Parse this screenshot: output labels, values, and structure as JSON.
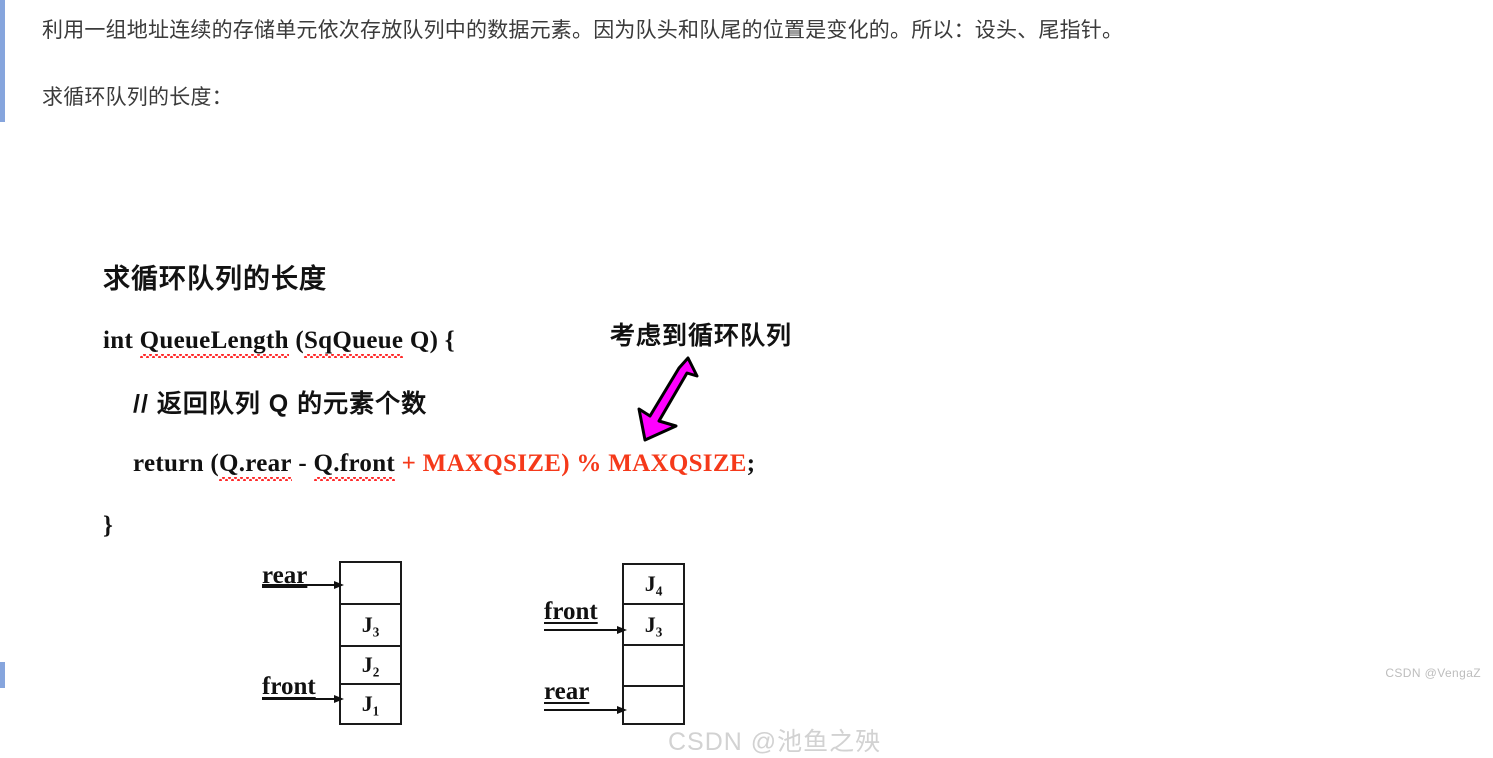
{
  "page": {
    "accent_color": "#86a5dd",
    "background": "#ffffff"
  },
  "article": {
    "paragraph_1": "利用一组地址连续的存储单元依次存放队列中的数据元素。因为队头和队尾的位置是变化的。所以：设头、尾指针。",
    "paragraph_2": "求循环队列的长度："
  },
  "slide": {
    "title": "求循环队列的长度",
    "code": {
      "signature_prefix": "int ",
      "signature_fn": "QueueLength",
      "signature_mid": " (",
      "signature_type": "SqQueue",
      "signature_suffix": " Q) {",
      "comment": "// 返回队列 Q 的元素个数",
      "return_keyword": "return (",
      "return_rear": "Q.rear",
      "return_minus": " - ",
      "return_front": "Q.front",
      "return_red": " + MAXQSIZE) % MAXQSIZE",
      "return_semicolon": ";",
      "close_brace": "}"
    },
    "annotation": {
      "label": "考虑到循环队列",
      "arrow_color": "#ff00ff",
      "arrow_outline": "#000000",
      "arrow_icon": "down-left-arrow-icon"
    },
    "code_highlight_color": "#f5391a",
    "diagram_left": {
      "name": "non-circular-queue-diagram",
      "cells": [
        "",
        "J₃",
        "J₂",
        "J₁"
      ],
      "pointers": [
        {
          "label": "rear",
          "cell_index": 0
        },
        {
          "label": "front",
          "cell_index": 3
        }
      ]
    },
    "diagram_right": {
      "name": "circular-queue-diagram",
      "cells": [
        "J₄",
        "J₃",
        "",
        ""
      ],
      "pointers": [
        {
          "label": "front",
          "cell_index": 1
        },
        {
          "label": "rear",
          "cell_index": 3
        }
      ]
    },
    "watermark": "CSDN @池鱼之殃"
  },
  "footer": {
    "watermark": "CSDN @VengaZ"
  }
}
